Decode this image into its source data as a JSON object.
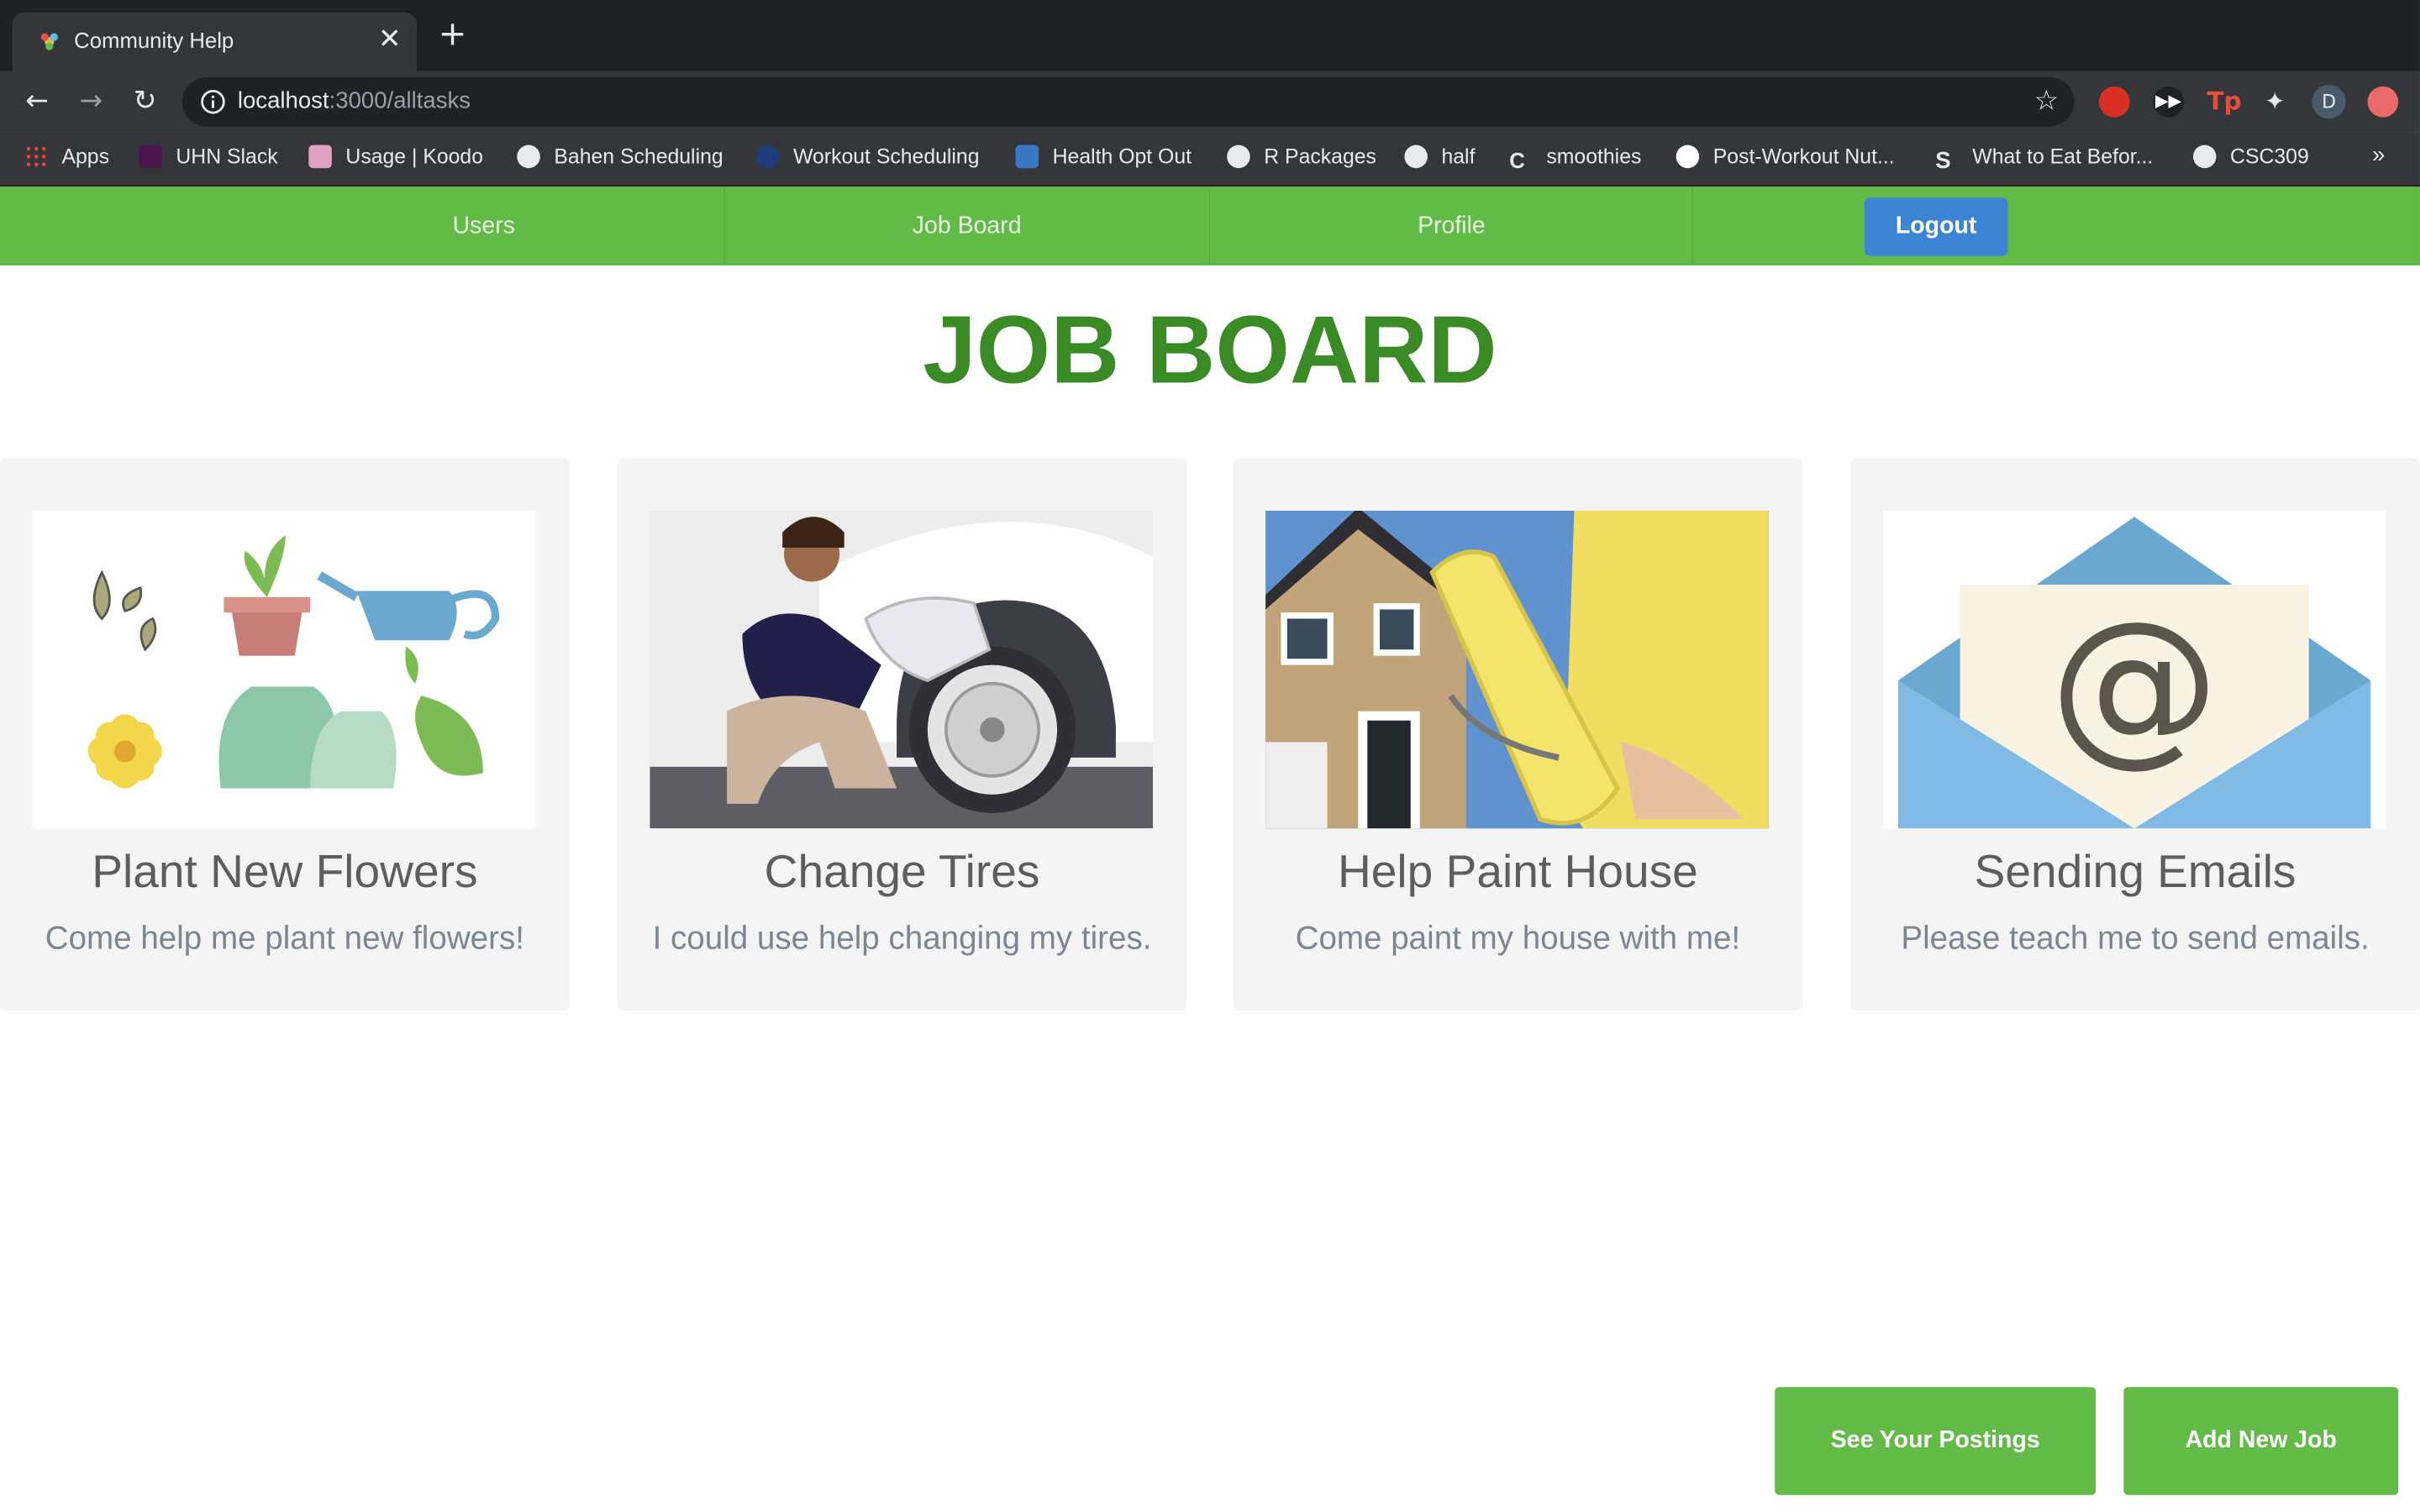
{
  "browser": {
    "tab_title": "Community Help",
    "url_host": "localhost",
    "url_path": ":3000/alltasks",
    "profile_initial": "D",
    "bookmarks": [
      "Apps",
      "UHN Slack",
      "Usage | Koodo",
      "Bahen Scheduling",
      "Workout Scheduling",
      "Health Opt Out",
      "R Packages",
      "half",
      "smoothies",
      "Post-Workout Nut...",
      "What to Eat Befor...",
      "CSC309"
    ],
    "more_bookmarks": "»"
  },
  "nav": {
    "users": "Users",
    "job_board": "Job Board",
    "profile": "Profile",
    "logout": "Logout"
  },
  "page_title": "JOB BOARD",
  "jobs": [
    {
      "title": "Plant New Flowers",
      "description": "Come help me plant new flowers!"
    },
    {
      "title": "Change Tires",
      "description": "I could use help changing my tires."
    },
    {
      "title": "Help Paint House",
      "description": "Come paint my house with me!"
    },
    {
      "title": "Sending Emails",
      "description": "Please teach me to send emails."
    }
  ],
  "actions": {
    "see_postings": "See Your Postings",
    "add_job": "Add New Job"
  },
  "colors": {
    "nav_green": "#62bb47",
    "title_green": "#3a8a25",
    "logout_blue": "#3d85d4"
  }
}
